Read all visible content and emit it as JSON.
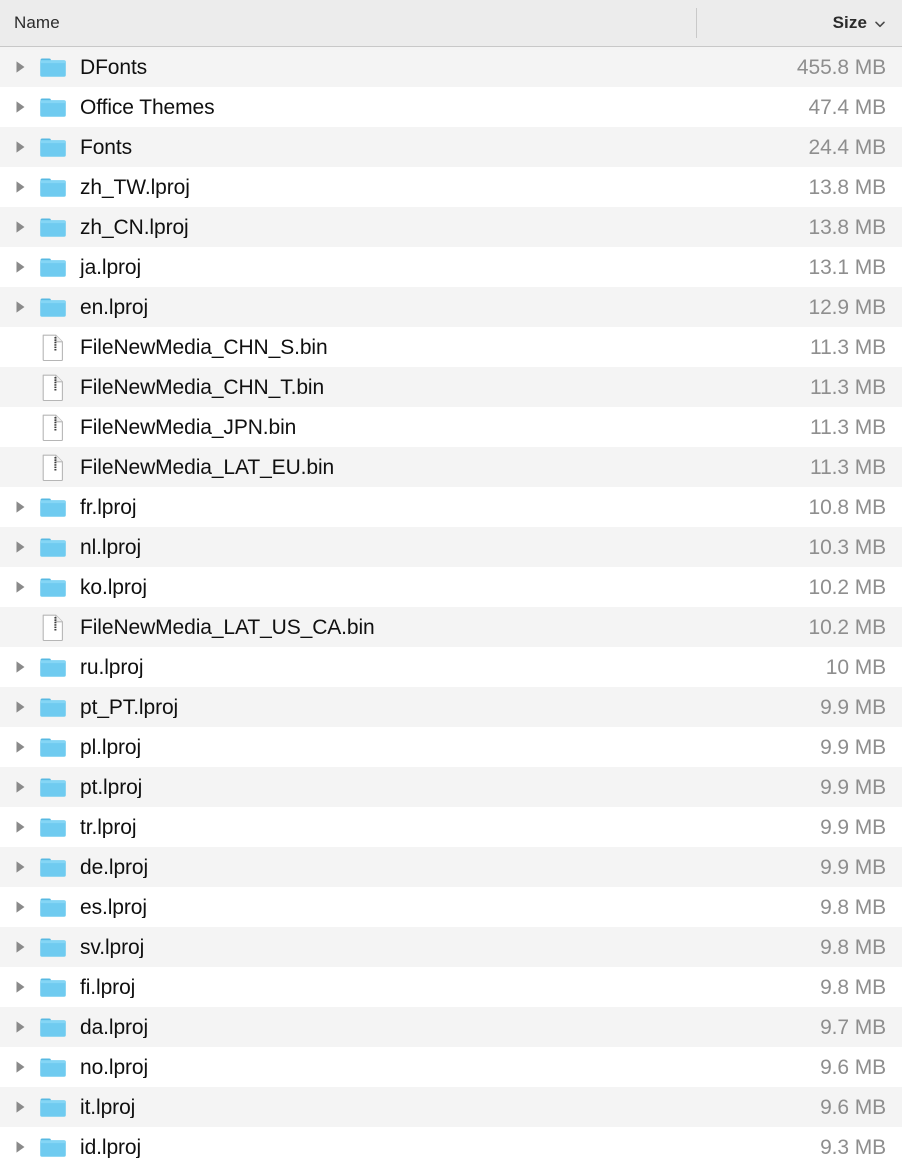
{
  "window": {
    "title": "Finder list view"
  },
  "columns": {
    "name": {
      "label": "Name",
      "sorted": false
    },
    "size": {
      "label": "Size",
      "sorted": true,
      "sort_direction": "descending",
      "sort_indicator": "chevron-down-icon"
    }
  },
  "colors": {
    "header_background": "#ececec",
    "header_border": "#c8c8c8",
    "row_background": "#ffffff",
    "row_alt_background": "#f4f4f4",
    "folder_icon": "#6fcbf0",
    "folder_icon_dark": "#57b9e2",
    "disclosure_triangle": "#8a8a8a",
    "name_text": "#101010",
    "size_text": "#8e8e8e",
    "header_text": "#2b2b2b"
  },
  "rows": [
    {
      "name": "DFonts",
      "size": "455.8 MB",
      "kind": "folder",
      "icon": "folder-icon",
      "expandable": true
    },
    {
      "name": "Office Themes",
      "size": "47.4 MB",
      "kind": "folder",
      "icon": "folder-icon",
      "expandable": true
    },
    {
      "name": "Fonts",
      "size": "24.4 MB",
      "kind": "folder",
      "icon": "folder-icon",
      "expandable": true
    },
    {
      "name": "zh_TW.lproj",
      "size": "13.8 MB",
      "kind": "folder",
      "icon": "folder-icon",
      "expandable": true
    },
    {
      "name": "zh_CN.lproj",
      "size": "13.8 MB",
      "kind": "folder",
      "icon": "folder-icon",
      "expandable": true
    },
    {
      "name": "ja.lproj",
      "size": "13.1 MB",
      "kind": "folder",
      "icon": "folder-icon",
      "expandable": true
    },
    {
      "name": "en.lproj",
      "size": "12.9 MB",
      "kind": "folder",
      "icon": "folder-icon",
      "expandable": true
    },
    {
      "name": "FileNewMedia_CHN_S.bin",
      "size": "11.3 MB",
      "kind": "file",
      "icon": "document-icon",
      "expandable": false
    },
    {
      "name": "FileNewMedia_CHN_T.bin",
      "size": "11.3 MB",
      "kind": "file",
      "icon": "document-icon",
      "expandable": false
    },
    {
      "name": "FileNewMedia_JPN.bin",
      "size": "11.3 MB",
      "kind": "file",
      "icon": "document-icon",
      "expandable": false
    },
    {
      "name": "FileNewMedia_LAT_EU.bin",
      "size": "11.3 MB",
      "kind": "file",
      "icon": "document-icon",
      "expandable": false
    },
    {
      "name": "fr.lproj",
      "size": "10.8 MB",
      "kind": "folder",
      "icon": "folder-icon",
      "expandable": true
    },
    {
      "name": "nl.lproj",
      "size": "10.3 MB",
      "kind": "folder",
      "icon": "folder-icon",
      "expandable": true
    },
    {
      "name": "ko.lproj",
      "size": "10.2 MB",
      "kind": "folder",
      "icon": "folder-icon",
      "expandable": true
    },
    {
      "name": "FileNewMedia_LAT_US_CA.bin",
      "size": "10.2 MB",
      "kind": "file",
      "icon": "document-icon",
      "expandable": false
    },
    {
      "name": "ru.lproj",
      "size": "10 MB",
      "kind": "folder",
      "icon": "folder-icon",
      "expandable": true
    },
    {
      "name": "pt_PT.lproj",
      "size": "9.9 MB",
      "kind": "folder",
      "icon": "folder-icon",
      "expandable": true
    },
    {
      "name": "pl.lproj",
      "size": "9.9 MB",
      "kind": "folder",
      "icon": "folder-icon",
      "expandable": true
    },
    {
      "name": "pt.lproj",
      "size": "9.9 MB",
      "kind": "folder",
      "icon": "folder-icon",
      "expandable": true
    },
    {
      "name": "tr.lproj",
      "size": "9.9 MB",
      "kind": "folder",
      "icon": "folder-icon",
      "expandable": true
    },
    {
      "name": "de.lproj",
      "size": "9.9 MB",
      "kind": "folder",
      "icon": "folder-icon",
      "expandable": true
    },
    {
      "name": "es.lproj",
      "size": "9.8 MB",
      "kind": "folder",
      "icon": "folder-icon",
      "expandable": true
    },
    {
      "name": "sv.lproj",
      "size": "9.8 MB",
      "kind": "folder",
      "icon": "folder-icon",
      "expandable": true
    },
    {
      "name": "fi.lproj",
      "size": "9.8 MB",
      "kind": "folder",
      "icon": "folder-icon",
      "expandable": true
    },
    {
      "name": "da.lproj",
      "size": "9.7 MB",
      "kind": "folder",
      "icon": "folder-icon",
      "expandable": true
    },
    {
      "name": "no.lproj",
      "size": "9.6 MB",
      "kind": "folder",
      "icon": "folder-icon",
      "expandable": true
    },
    {
      "name": "it.lproj",
      "size": "9.6 MB",
      "kind": "folder",
      "icon": "folder-icon",
      "expandable": true
    },
    {
      "name": "id.lproj",
      "size": "9.3 MB",
      "kind": "folder",
      "icon": "folder-icon",
      "expandable": true
    }
  ]
}
